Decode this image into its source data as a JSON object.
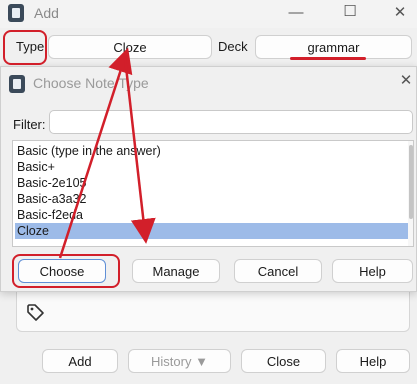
{
  "add_window": {
    "title": "Add",
    "type_label": "Type",
    "type_value": "Cloze",
    "deck_label": "Deck",
    "deck_value": "grammar",
    "controls": {
      "minimize": "—",
      "maximize": "☐",
      "close": "✕"
    },
    "buttons": {
      "add": "Add",
      "history": "History ▼",
      "close": "Close",
      "help": "Help"
    }
  },
  "dialog": {
    "title": "Choose Note Type",
    "close_glyph": "✕",
    "filter_label": "Filter:",
    "filter_value": "",
    "items": [
      "Basic (type in the answer)",
      "Basic+",
      "Basic-2e105",
      "Basic-a3a32",
      "Basic-f2eda",
      "Cloze"
    ],
    "selected_item": "Cloze",
    "buttons": {
      "choose": "Choose",
      "manage": "Manage",
      "cancel": "Cancel",
      "help": "Help"
    }
  },
  "colors": {
    "annotation": "#d21f2a",
    "selection": "#9dbbe8",
    "default_button_border": "#5f8fd6"
  },
  "icons": [
    "app-icon",
    "tag-icon",
    "close-icon",
    "minimize-icon",
    "maximize-icon"
  ]
}
